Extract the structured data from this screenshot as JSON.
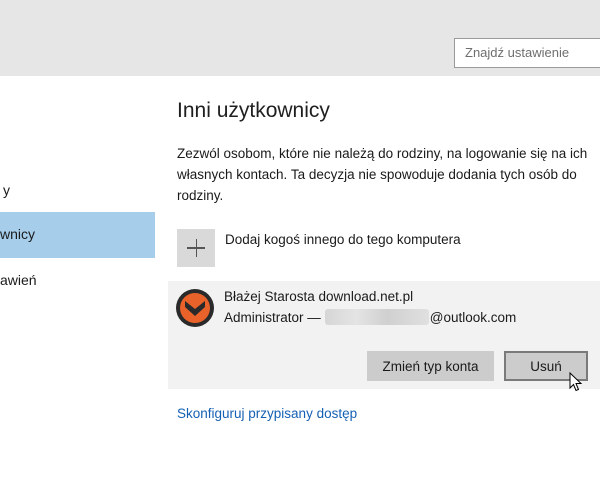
{
  "search": {
    "placeholder": "Znajdź ustawienie"
  },
  "sidebar": {
    "items": [
      {
        "label": "Rodzina i inni użytkownicy",
        "visible": "y"
      },
      {
        "label": "Inni użytkownicy",
        "visible": "wnicy",
        "selected": true
      },
      {
        "label": "Synchronizuj ustawienia",
        "visible": "awień"
      }
    ]
  },
  "main": {
    "title": "Inni użytkownicy",
    "description": "Zezwól osobom, które nie należą do rodziny, na logowanie się na ich własnych kontach. Ta decyzja nie spowoduje dodania tych osób do rodziny.",
    "add_user_label": "Dodaj kogoś innego do tego komputera",
    "user": {
      "name": "Błażej Starosta download.net.pl",
      "role": "Administrator —",
      "email_suffix": "@outlook.com",
      "change_type_button": "Zmień typ konta",
      "remove_button": "Usuń"
    },
    "assigned_access_link": "Skonfiguruj przypisany dostęp"
  },
  "colors": {
    "selected": "#a6cdea",
    "link": "#1560b3",
    "avatar_orange": "#e8622a"
  },
  "icons": [
    "plus-icon",
    "avatar-icon",
    "mouse-cursor-icon"
  ]
}
